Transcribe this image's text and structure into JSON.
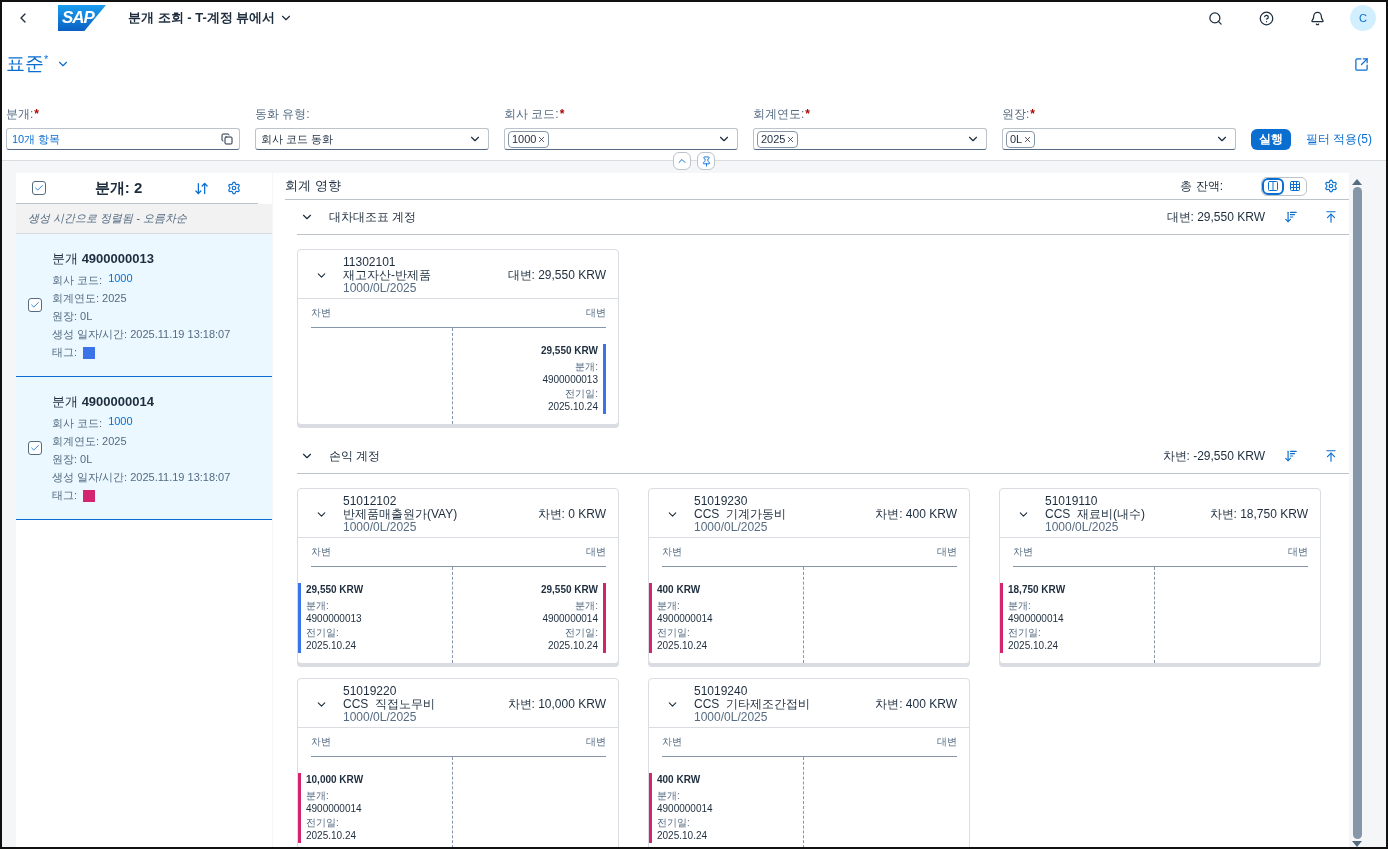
{
  "header": {
    "logo": "SAP",
    "title": "분개 조회 - T-계정 뷰에서",
    "avatar": "C"
  },
  "variant": {
    "name": "표준",
    "modified_mark": "*"
  },
  "filters": [
    {
      "label": "분개:",
      "required": true,
      "kind": "value",
      "value": "10개 항목"
    },
    {
      "label": "동화 유형:",
      "required": false,
      "kind": "select",
      "value": "회사 코드 동화"
    },
    {
      "label": "회사 코드:",
      "required": true,
      "kind": "tokens",
      "tokens": [
        "1000"
      ]
    },
    {
      "label": "회계연도:",
      "required": true,
      "kind": "tokens",
      "tokens": [
        "2025"
      ]
    },
    {
      "label": "원장:",
      "required": true,
      "kind": "tokens",
      "tokens": [
        "0L"
      ]
    }
  ],
  "go_button": "실행",
  "adapt_filters": "필터 적용(5)",
  "journal_list": {
    "title": "분개: 2",
    "all_checked": true,
    "sort_info": "생성 시간으로 정렬됨 - 오름차순",
    "items": [
      {
        "title": "분개 **4900000013**",
        "checked": true,
        "selected": true,
        "company_label": "회사 코드:",
        "company": "1000",
        "lines": [
          "회계연도: 2025",
          "원장: 0L",
          "생성 일자/시간: 2025.11.19 13:18:07"
        ],
        "tag_label": "태그:",
        "color": "#3b73e8"
      },
      {
        "title": "분개 **4900000014**",
        "checked": true,
        "selected": true,
        "company_label": "회사 코드:",
        "company": "1000",
        "lines": [
          "회계연도: 2025",
          "원장: 0L",
          "생성 일자/시간: 2025.11.19 13:18:07"
        ],
        "tag_label": "태그:",
        "color": "#d3246f"
      }
    ]
  },
  "impact": {
    "title": "회계 영향",
    "total_label": "총 잔액:",
    "view_modes": [
      {
        "kind": "t-account",
        "selected": true
      },
      {
        "kind": "grid",
        "selected": false
      }
    ],
    "sections": [
      {
        "title": "대차대조표 계정",
        "expanded": true,
        "balance": "대변: 29,550 KRW",
        "accounts": [
          {
            "number": "11302101",
            "name": "재고자산-반제품",
            "path": "1000/0L/2025",
            "balance": "대변: 29,550 KRW",
            "debit_label": "차변",
            "credit_label": "대변",
            "credit": [
              {
                "amount": "29,550 KRW",
                "doc_label": "분개:",
                "doc": "4900000013",
                "date_label": "전기일:",
                "date": "2025.10.24",
                "color": "#3b73e8"
              }
            ]
          }
        ]
      },
      {
        "title": "손익 계정",
        "expanded": true,
        "balance": "차변: -29,550 KRW",
        "accounts": [
          {
            "number": "51012102",
            "name": "반제품매출원가(VAY)",
            "path": "1000/0L/2025",
            "balance": "차변: 0 KRW",
            "debit_label": "차변",
            "credit_label": "대변",
            "debit": [
              {
                "amount": "29,550 KRW",
                "doc_label": "분개:",
                "doc": "4900000013",
                "date_label": "전기일:",
                "date": "2025.10.24",
                "color": "#3b73e8"
              }
            ],
            "credit": [
              {
                "amount": "29,550 KRW",
                "doc_label": "분개:",
                "doc": "4900000014",
                "date_label": "전기일:",
                "date": "2025.10.24",
                "color": "#d3246f"
              }
            ]
          },
          {
            "number": "51019230",
            "name": "CCS  기계가동비",
            "path": "1000/0L/2025",
            "balance": "차변: 400 KRW",
            "debit_label": "차변",
            "credit_label": "대변",
            "debit": [
              {
                "amount": "400 KRW",
                "doc_label": "분개:",
                "doc": "4900000014",
                "date_label": "전기일:",
                "date": "2025.10.24",
                "color": "#d3246f"
              }
            ]
          },
          {
            "number": "51019110",
            "name": "CCS  재료비(내수)",
            "path": "1000/0L/2025",
            "balance": "차변: 18,750 KRW",
            "debit_label": "차변",
            "credit_label": "대변",
            "debit": [
              {
                "amount": "18,750 KRW",
                "doc_label": "분개:",
                "doc": "4900000014",
                "date_label": "전기일:",
                "date": "2025.10.24",
                "color": "#d3246f"
              }
            ]
          },
          {
            "number": "51019220",
            "name": "CCS  직접노무비",
            "path": "1000/0L/2025",
            "balance": "차변: 10,000 KRW",
            "debit_label": "차변",
            "credit_label": "대변",
            "debit": [
              {
                "amount": "10,000 KRW",
                "doc_label": "분개:",
                "doc": "4900000014",
                "date_label": "전기일:",
                "date": "2025.10.24",
                "color": "#d3246f"
              }
            ]
          },
          {
            "number": "51019240",
            "name": "CCS  기타제조간접비",
            "path": "1000/0L/2025",
            "balance": "차변: 400 KRW",
            "debit_label": "차변",
            "credit_label": "대변",
            "debit": [
              {
                "amount": "400 KRW",
                "doc_label": "분개:",
                "doc": "4900000014",
                "date_label": "전기일:",
                "date": "2025.10.24",
                "color": "#d3246f"
              }
            ]
          }
        ]
      }
    ]
  }
}
